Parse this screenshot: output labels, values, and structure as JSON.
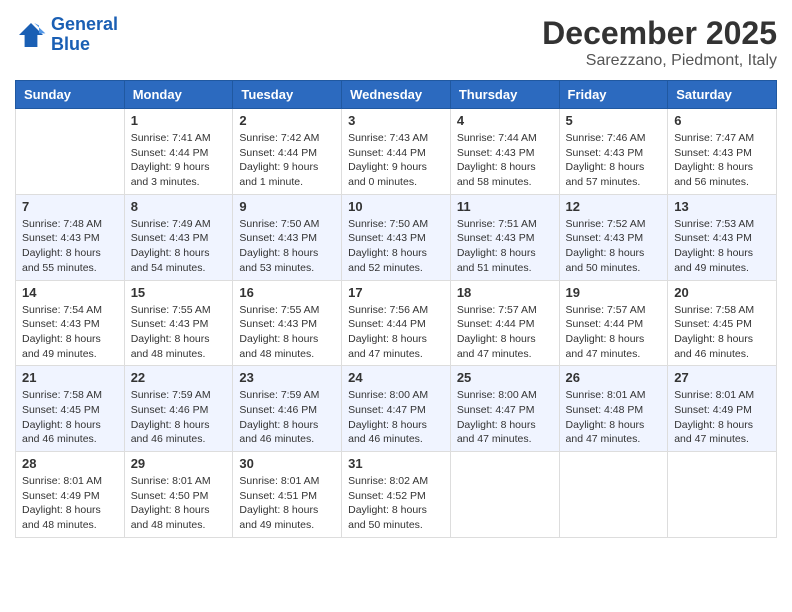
{
  "logo": {
    "line1": "General",
    "line2": "Blue"
  },
  "title": "December 2025",
  "location": "Sarezzano, Piedmont, Italy",
  "days_of_week": [
    "Sunday",
    "Monday",
    "Tuesday",
    "Wednesday",
    "Thursday",
    "Friday",
    "Saturday"
  ],
  "weeks": [
    [
      {
        "day": "",
        "sunrise": "",
        "sunset": "",
        "daylight": ""
      },
      {
        "day": "1",
        "sunrise": "Sunrise: 7:41 AM",
        "sunset": "Sunset: 4:44 PM",
        "daylight": "Daylight: 9 hours and 3 minutes."
      },
      {
        "day": "2",
        "sunrise": "Sunrise: 7:42 AM",
        "sunset": "Sunset: 4:44 PM",
        "daylight": "Daylight: 9 hours and 1 minute."
      },
      {
        "day": "3",
        "sunrise": "Sunrise: 7:43 AM",
        "sunset": "Sunset: 4:44 PM",
        "daylight": "Daylight: 9 hours and 0 minutes."
      },
      {
        "day": "4",
        "sunrise": "Sunrise: 7:44 AM",
        "sunset": "Sunset: 4:43 PM",
        "daylight": "Daylight: 8 hours and 58 minutes."
      },
      {
        "day": "5",
        "sunrise": "Sunrise: 7:46 AM",
        "sunset": "Sunset: 4:43 PM",
        "daylight": "Daylight: 8 hours and 57 minutes."
      },
      {
        "day": "6",
        "sunrise": "Sunrise: 7:47 AM",
        "sunset": "Sunset: 4:43 PM",
        "daylight": "Daylight: 8 hours and 56 minutes."
      }
    ],
    [
      {
        "day": "7",
        "sunrise": "Sunrise: 7:48 AM",
        "sunset": "Sunset: 4:43 PM",
        "daylight": "Daylight: 8 hours and 55 minutes."
      },
      {
        "day": "8",
        "sunrise": "Sunrise: 7:49 AM",
        "sunset": "Sunset: 4:43 PM",
        "daylight": "Daylight: 8 hours and 54 minutes."
      },
      {
        "day": "9",
        "sunrise": "Sunrise: 7:50 AM",
        "sunset": "Sunset: 4:43 PM",
        "daylight": "Daylight: 8 hours and 53 minutes."
      },
      {
        "day": "10",
        "sunrise": "Sunrise: 7:50 AM",
        "sunset": "Sunset: 4:43 PM",
        "daylight": "Daylight: 8 hours and 52 minutes."
      },
      {
        "day": "11",
        "sunrise": "Sunrise: 7:51 AM",
        "sunset": "Sunset: 4:43 PM",
        "daylight": "Daylight: 8 hours and 51 minutes."
      },
      {
        "day": "12",
        "sunrise": "Sunrise: 7:52 AM",
        "sunset": "Sunset: 4:43 PM",
        "daylight": "Daylight: 8 hours and 50 minutes."
      },
      {
        "day": "13",
        "sunrise": "Sunrise: 7:53 AM",
        "sunset": "Sunset: 4:43 PM",
        "daylight": "Daylight: 8 hours and 49 minutes."
      }
    ],
    [
      {
        "day": "14",
        "sunrise": "Sunrise: 7:54 AM",
        "sunset": "Sunset: 4:43 PM",
        "daylight": "Daylight: 8 hours and 49 minutes."
      },
      {
        "day": "15",
        "sunrise": "Sunrise: 7:55 AM",
        "sunset": "Sunset: 4:43 PM",
        "daylight": "Daylight: 8 hours and 48 minutes."
      },
      {
        "day": "16",
        "sunrise": "Sunrise: 7:55 AM",
        "sunset": "Sunset: 4:43 PM",
        "daylight": "Daylight: 8 hours and 48 minutes."
      },
      {
        "day": "17",
        "sunrise": "Sunrise: 7:56 AM",
        "sunset": "Sunset: 4:44 PM",
        "daylight": "Daylight: 8 hours and 47 minutes."
      },
      {
        "day": "18",
        "sunrise": "Sunrise: 7:57 AM",
        "sunset": "Sunset: 4:44 PM",
        "daylight": "Daylight: 8 hours and 47 minutes."
      },
      {
        "day": "19",
        "sunrise": "Sunrise: 7:57 AM",
        "sunset": "Sunset: 4:44 PM",
        "daylight": "Daylight: 8 hours and 47 minutes."
      },
      {
        "day": "20",
        "sunrise": "Sunrise: 7:58 AM",
        "sunset": "Sunset: 4:45 PM",
        "daylight": "Daylight: 8 hours and 46 minutes."
      }
    ],
    [
      {
        "day": "21",
        "sunrise": "Sunrise: 7:58 AM",
        "sunset": "Sunset: 4:45 PM",
        "daylight": "Daylight: 8 hours and 46 minutes."
      },
      {
        "day": "22",
        "sunrise": "Sunrise: 7:59 AM",
        "sunset": "Sunset: 4:46 PM",
        "daylight": "Daylight: 8 hours and 46 minutes."
      },
      {
        "day": "23",
        "sunrise": "Sunrise: 7:59 AM",
        "sunset": "Sunset: 4:46 PM",
        "daylight": "Daylight: 8 hours and 46 minutes."
      },
      {
        "day": "24",
        "sunrise": "Sunrise: 8:00 AM",
        "sunset": "Sunset: 4:47 PM",
        "daylight": "Daylight: 8 hours and 46 minutes."
      },
      {
        "day": "25",
        "sunrise": "Sunrise: 8:00 AM",
        "sunset": "Sunset: 4:47 PM",
        "daylight": "Daylight: 8 hours and 47 minutes."
      },
      {
        "day": "26",
        "sunrise": "Sunrise: 8:01 AM",
        "sunset": "Sunset: 4:48 PM",
        "daylight": "Daylight: 8 hours and 47 minutes."
      },
      {
        "day": "27",
        "sunrise": "Sunrise: 8:01 AM",
        "sunset": "Sunset: 4:49 PM",
        "daylight": "Daylight: 8 hours and 47 minutes."
      }
    ],
    [
      {
        "day": "28",
        "sunrise": "Sunrise: 8:01 AM",
        "sunset": "Sunset: 4:49 PM",
        "daylight": "Daylight: 8 hours and 48 minutes."
      },
      {
        "day": "29",
        "sunrise": "Sunrise: 8:01 AM",
        "sunset": "Sunset: 4:50 PM",
        "daylight": "Daylight: 8 hours and 48 minutes."
      },
      {
        "day": "30",
        "sunrise": "Sunrise: 8:01 AM",
        "sunset": "Sunset: 4:51 PM",
        "daylight": "Daylight: 8 hours and 49 minutes."
      },
      {
        "day": "31",
        "sunrise": "Sunrise: 8:02 AM",
        "sunset": "Sunset: 4:52 PM",
        "daylight": "Daylight: 8 hours and 50 minutes."
      },
      {
        "day": "",
        "sunrise": "",
        "sunset": "",
        "daylight": ""
      },
      {
        "day": "",
        "sunrise": "",
        "sunset": "",
        "daylight": ""
      },
      {
        "day": "",
        "sunrise": "",
        "sunset": "",
        "daylight": ""
      }
    ]
  ]
}
